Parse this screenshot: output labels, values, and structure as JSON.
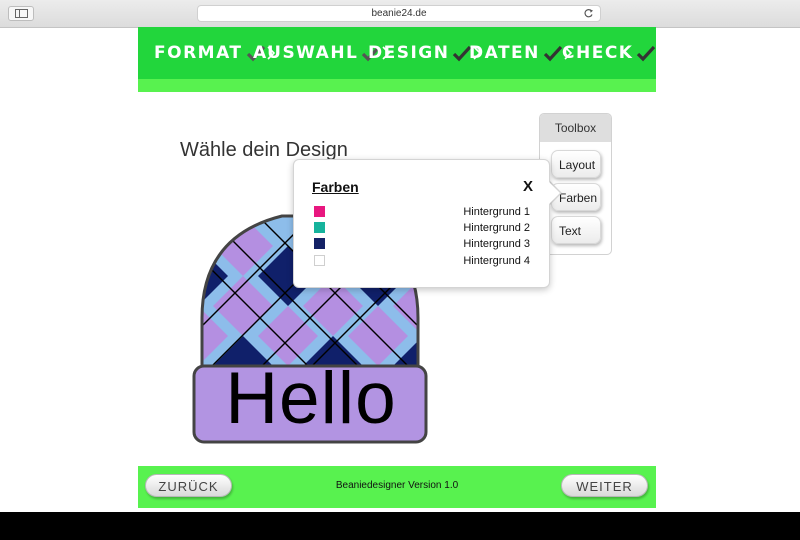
{
  "browser": {
    "url": "beanie24.de"
  },
  "steps": [
    {
      "label": "FORMAT",
      "done": true
    },
    {
      "label": "AUSWAHL",
      "done": true
    },
    {
      "label": "DESIGN",
      "done": true
    },
    {
      "label": "DATEN",
      "done": true
    },
    {
      "label": "CHECK",
      "done": true
    }
  ],
  "page": {
    "title": "Wähle dein Design"
  },
  "toolbox": {
    "title": "Toolbox",
    "buttons": [
      "Layout",
      "Farben",
      "Text"
    ]
  },
  "colors_popover": {
    "title": "Farben",
    "close_label": "X",
    "items": [
      {
        "label": "Hintergrund 1",
        "color": "#e8177f"
      },
      {
        "label": "Hintergrund 2",
        "color": "#16b39c"
      },
      {
        "label": "Hintergrund 3",
        "color": "#142266"
      },
      {
        "label": "Hintergrund 4",
        "color": "#ffffff"
      }
    ]
  },
  "beanie": {
    "text": "Hello",
    "colors": {
      "light_blue": "#8dbdea",
      "lavender": "#b48fe1",
      "navy": "#10206a",
      "band": "#b294e2",
      "outline": "#444444"
    }
  },
  "footer": {
    "back_label": "ZURÜCK",
    "next_label": "WEITER",
    "version": "Beaniedesigner Version 1.0"
  },
  "theme": {
    "header_green": "#22d63c",
    "strip_green": "#58f24f"
  }
}
